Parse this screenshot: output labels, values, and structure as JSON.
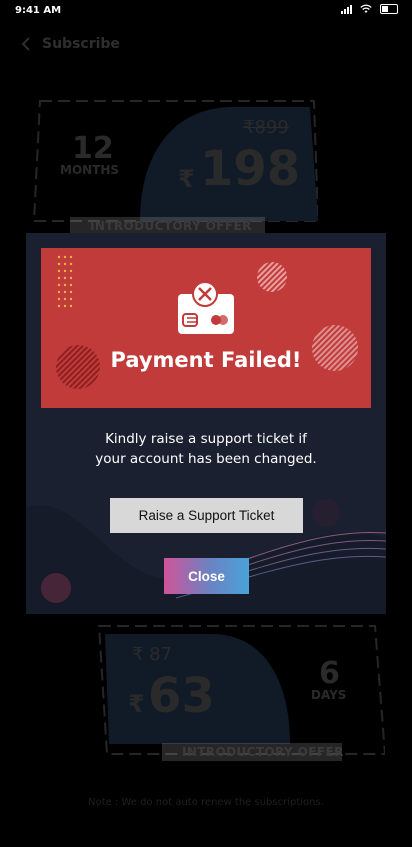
{
  "status_bar": {
    "time": "9:41 AM"
  },
  "header": {
    "title": "Subscribe"
  },
  "plans": [
    {
      "duration_value": "12",
      "duration_unit": "MONTHS",
      "original_price": "₹899",
      "currency": "₹",
      "price": "198",
      "badge": "INTRODUCTORY OFFER"
    },
    {
      "duration_value": "6",
      "duration_unit": "DAYS",
      "original_price": "₹ 87",
      "currency": "₹",
      "price": "63",
      "badge": "INTRODUCTORY OFFER"
    }
  ],
  "note": "Note : We do not auto renew the subscriptions.",
  "modal": {
    "title": "Payment Failed!",
    "message_line1": "Kindly raise a support ticket if",
    "message_line2": "your account has been changed.",
    "support_button": "Raise a Support Ticket",
    "close_button": "Close"
  },
  "colors": {
    "banner": "#c23b3b",
    "modal_bg": "#1b2030",
    "support_button_bg": "#d8d8d8",
    "close_gradient_start": "#d05499",
    "close_gradient_end": "#4aa3d8"
  }
}
